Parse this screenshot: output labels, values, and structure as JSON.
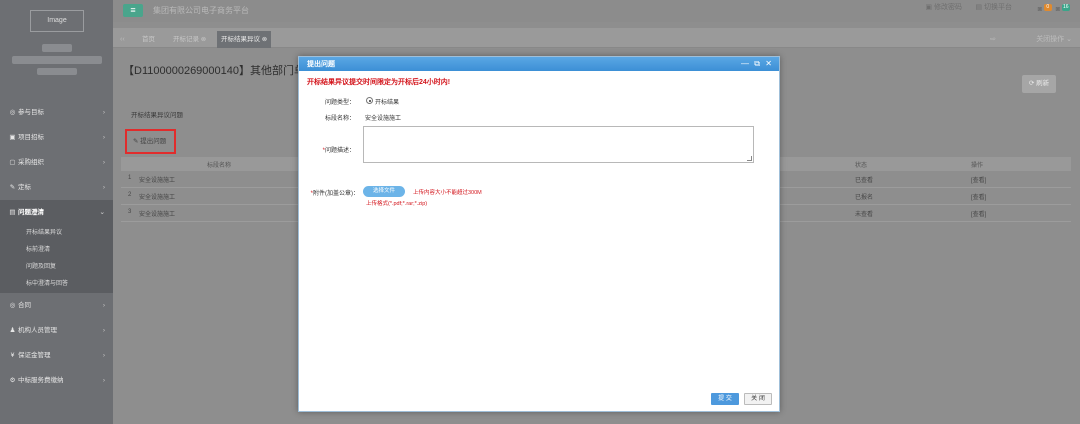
{
  "sidebar": {
    "logo": "Image",
    "nav": [
      {
        "icon": "◎",
        "label": "参与目标",
        "arrow": "›"
      },
      {
        "icon": "▣",
        "label": "项目招标",
        "arrow": "›"
      },
      {
        "icon": "▢",
        "label": "采购组织",
        "arrow": "›"
      },
      {
        "icon": "✎",
        "label": "定标",
        "arrow": "›"
      },
      {
        "icon": "▤",
        "label": "问题澄清",
        "arrow": "⌄"
      }
    ],
    "sub": [
      "开标结果异议",
      "标前澄清",
      "问题及回复",
      "标中澄清与回答"
    ],
    "nav2": [
      {
        "icon": "◎",
        "label": "合同",
        "arrow": "›"
      },
      {
        "icon": "♟",
        "label": "机构人员管理",
        "arrow": "›"
      },
      {
        "icon": "¥",
        "label": "保证金管理",
        "arrow": "›"
      },
      {
        "icon": "⚙",
        "label": "中标服务费缴纳",
        "arrow": "›"
      }
    ]
  },
  "header": {
    "menu_glyph": "≡",
    "site_title": "集团有限公司电子商务平台",
    "right_items": [
      "修改密码",
      "切换平台"
    ],
    "badges": [
      "0",
      "16"
    ]
  },
  "tabs": {
    "back": "‹‹",
    "items": [
      "首页",
      "开标记录 ⊗",
      "开标结果异议 ⊗"
    ],
    "forward": "⇨",
    "close_ops": "关闭操作 ⌄"
  },
  "content": {
    "heading": "【D1100000269000140】其他部门单个",
    "refresh": "⟳ 刷新",
    "section_label": "开标结果异议问题",
    "raise_button": "提出问题",
    "table": {
      "headers": [
        "标段名称",
        "状态",
        "操作"
      ],
      "rows": [
        {
          "no": "1",
          "name": "安全设施施工",
          "status": "已查看",
          "op": "[查看]"
        },
        {
          "no": "2",
          "name": "安全设施施工",
          "status": "已报名",
          "op": "[查看]"
        },
        {
          "no": "3",
          "name": "安全设施施工",
          "status": "未查看",
          "op": "[查看]"
        }
      ]
    }
  },
  "modal": {
    "title": "提出问题",
    "controls": [
      "—",
      "⧉",
      "✕"
    ],
    "notice": "开标结果异议提交时间限定为开标后24小时内!",
    "problem_type_label": "问题类型：",
    "problem_type_value": "开标结果",
    "section_name_label": "标段名称：",
    "section_name_value": "安全设施施工",
    "desc_label": "问题描述：",
    "desc_required": "*",
    "attach_label": "附件(加盖公章)：",
    "attach_required": "*",
    "choose_file": "选择文件",
    "size_hint": "上传内容大小不能超过300M",
    "format_hint": "上传格式(*.pdf;*.rar;*.zip)",
    "submit": "提 交",
    "close": "关 闭"
  }
}
